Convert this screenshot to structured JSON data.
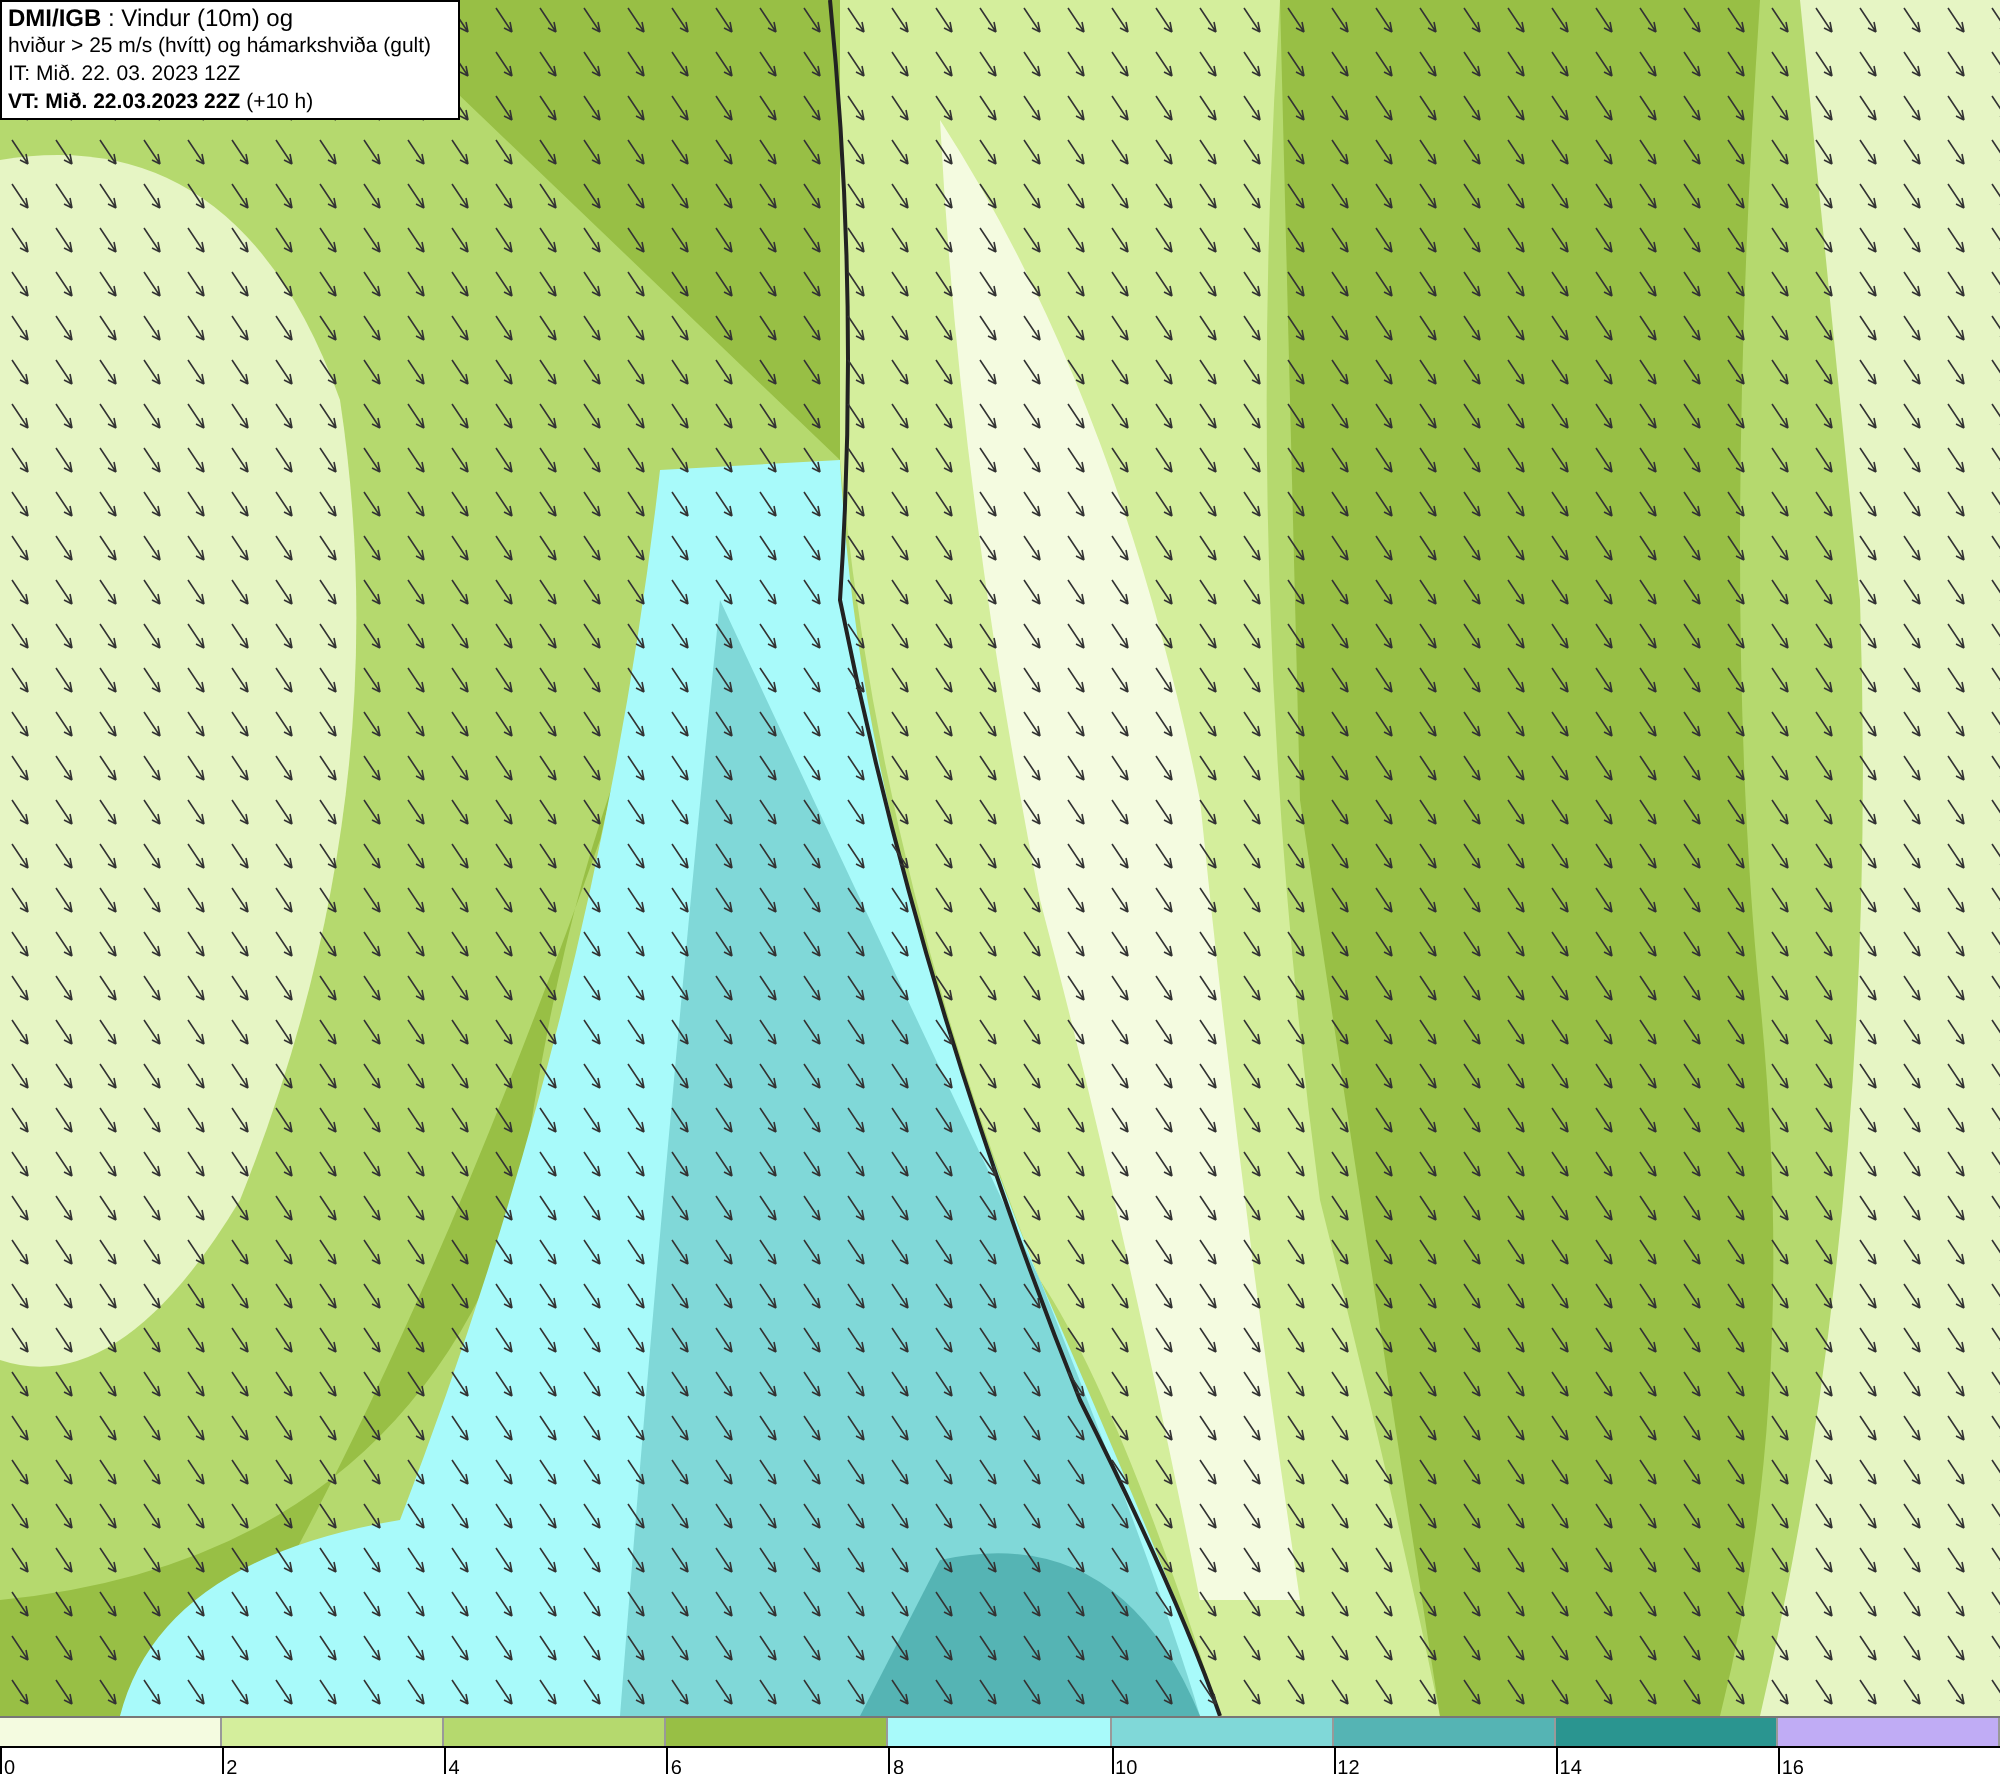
{
  "legend": {
    "lines": [
      "**DMI/IGB** : Vindur (10m) og",
      "hviður > 25 m/s (hvítt) og hámarkshviða (gult)",
      "IT: Mið. 22. 03. 2023 12Z",
      "**VT: Mið. 22.03.2023 22Z** (+10 h)"
    ]
  },
  "colorbar": {
    "segments": [
      {
        "color": "#f4fbe0",
        "tick": "0"
      },
      {
        "color": "#d4ee9c",
        "tick": "2"
      },
      {
        "color": "#b5d96e",
        "tick": "4"
      },
      {
        "color": "#98bf45",
        "tick": "6"
      },
      {
        "color": "#a8fafa",
        "tick": "8"
      },
      {
        "color": "#80d8d8",
        "tick": "10"
      },
      {
        "color": "#55b4b4",
        "tick": "12"
      },
      {
        "color": "#2a9590",
        "tick": "14"
      },
      {
        "color": "#c0acf5",
        "tick": "16"
      }
    ]
  }
}
